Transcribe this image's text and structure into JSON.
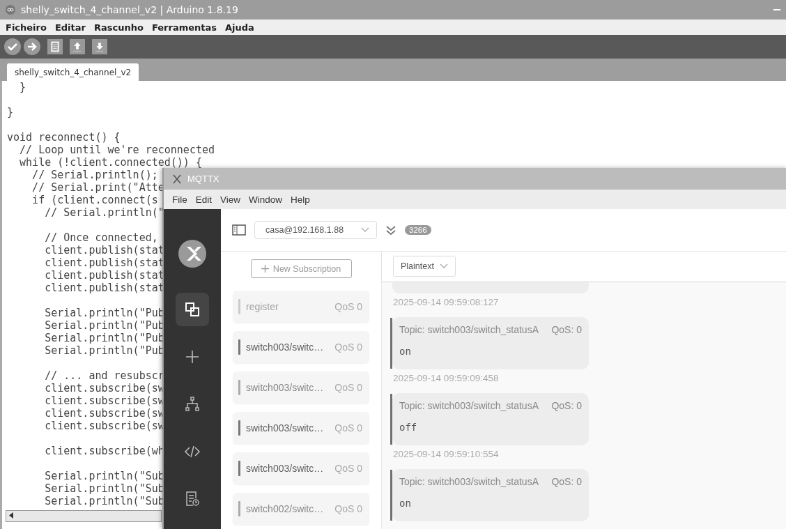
{
  "window": {
    "title": "shelly_switch_4_channel_v2 | Arduino 1.8.19"
  },
  "menu": [
    "Ficheiro",
    "Editar",
    "Rascunho",
    "Ferramentas",
    "Ajuda"
  ],
  "toolbar": [
    {
      "kind": "verify"
    },
    {
      "kind": "upload"
    },
    {
      "kind": "new"
    },
    {
      "kind": "open"
    },
    {
      "kind": "save"
    }
  ],
  "tabs": [
    {
      "label": "shelly_switch_4_channel_v2",
      "selected": true
    }
  ],
  "code_blocks": [
    [
      "  }"
    ],
    [
      "}"
    ],
    [
      "void reconnect() {",
      "  // Loop until we're reconnected",
      "  while (!client.connected()) {",
      "    // Serial.println();",
      "    // Serial.print(\"Atte",
      "    if (client.connect(s",
      "      // Serial.println(\""
    ],
    [
      "      // Once connected,",
      "      client.publish(stat",
      "      client.publish(stat",
      "      client.publish(stat",
      "      client.publish(stat"
    ],
    [
      "      Serial.println(\"Pub",
      "      Serial.println(\"Pub",
      "      Serial.println(\"Pub",
      "      Serial.println(\"Pub"
    ],
    [
      "      // ... and resubscr",
      "      client.subscribe(sw",
      "      client.subscribe(sw",
      "      client.subscribe(sw",
      "      client.subscribe(sw"
    ],
    [
      "      client.subscribe(wh"
    ],
    [
      "      Serial.println(\"Sub",
      "      Serial.println(\"Sub",
      "      Serial.println(\"Sub"
    ]
  ],
  "mqttx": {
    "title": "MQTTX",
    "menu": [
      "File",
      "Edit",
      "View",
      "Window",
      "Help"
    ],
    "nav": [
      {
        "kind": "connections",
        "selected": true
      },
      {
        "kind": "new",
        "selected": false
      },
      {
        "kind": "tree",
        "selected": false
      },
      {
        "kind": "script",
        "selected": false
      },
      {
        "kind": "log",
        "selected": false
      }
    ],
    "connection": "casa@192.168.1.88",
    "message_count": "3266",
    "new_subscription": "New Subscription",
    "subscriptions": [
      {
        "topic": "register",
        "qos": "QoS 0",
        "color": "#cccccc"
      },
      {
        "topic": "switch003/switc…",
        "qos": "QoS 0",
        "color": "#777777"
      },
      {
        "topic": "switch003/switc…",
        "qos": "QoS 0",
        "color": "#aaaaaa"
      },
      {
        "topic": "switch003/switc…",
        "qos": "QoS 0",
        "color": "#777777"
      },
      {
        "topic": "switch003/switc…",
        "qos": "QoS 0",
        "color": "#777777"
      },
      {
        "topic": "switch002/switc…",
        "qos": "QoS 0",
        "color": "#aaaaaa"
      }
    ],
    "payload_format": "Plaintext",
    "messages": [
      {
        "time": "2025-09-14 09:59:08:127"
      },
      {
        "topic": "Topic: switch003/switch_statusA",
        "qos": "QoS: 0",
        "payload": "on",
        "time": "2025-09-14 09:59:09:458"
      },
      {
        "topic": "Topic: switch003/switch_statusA",
        "qos": "QoS: 0",
        "payload": "off",
        "time": "2025-09-14 09:59:10:554"
      },
      {
        "topic": "Topic: switch003/switch_statusA",
        "qos": "QoS: 0",
        "payload": "on"
      }
    ]
  }
}
